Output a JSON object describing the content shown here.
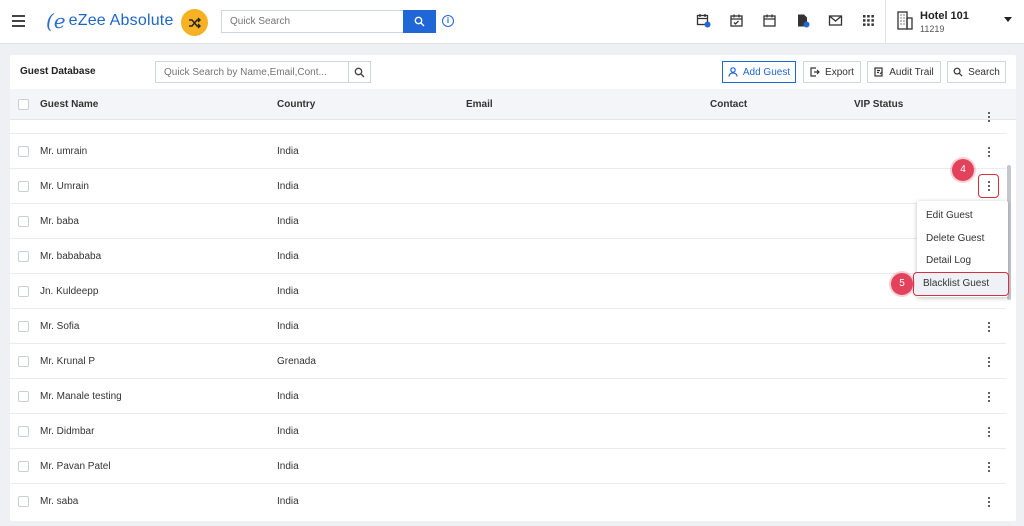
{
  "app": {
    "title": "eZee Absolute"
  },
  "topbar": {
    "search_placeholder": "Quick Search",
    "hotel_name": "Hotel 101",
    "hotel_code": "11219"
  },
  "guest_db": {
    "title": "Guest Database",
    "search_placeholder": "Quick Search by Name,Email,Cont...",
    "buttons": {
      "add": "Add Guest",
      "export": "Export",
      "audit": "Audit Trail",
      "search": "Search"
    },
    "columns": [
      "Guest Name",
      "Country",
      "Email",
      "Contact",
      "VIP Status"
    ],
    "rows": [
      {
        "name": "Mr. umrain",
        "country": "India"
      },
      {
        "name": "Mr. Umrain",
        "country": "India"
      },
      {
        "name": "Mr. baba",
        "country": "India"
      },
      {
        "name": "Mr. babababa",
        "country": "India"
      },
      {
        "name": "Jn. Kuldeepp",
        "country": "India"
      },
      {
        "name": "Mr. Sofia",
        "country": "India"
      },
      {
        "name": "Mr. Krunal P",
        "country": "Grenada"
      },
      {
        "name": "Mr. Manale testing",
        "country": "India"
      },
      {
        "name": "Mr. Didmbar",
        "country": "India"
      },
      {
        "name": "Mr. Pavan Patel",
        "country": "India"
      },
      {
        "name": "Mr. saba",
        "country": "India"
      }
    ]
  },
  "row_menu": {
    "items": [
      "Edit Guest",
      "Delete Guest",
      "Detail Log",
      "Blacklist Guest"
    ]
  },
  "step_badges": [
    "4",
    "5"
  ],
  "colors": {
    "accent": "#1f66d6",
    "highlight": "#d8303f",
    "badge": "#e2425c",
    "shuffle": "#f6b223"
  }
}
